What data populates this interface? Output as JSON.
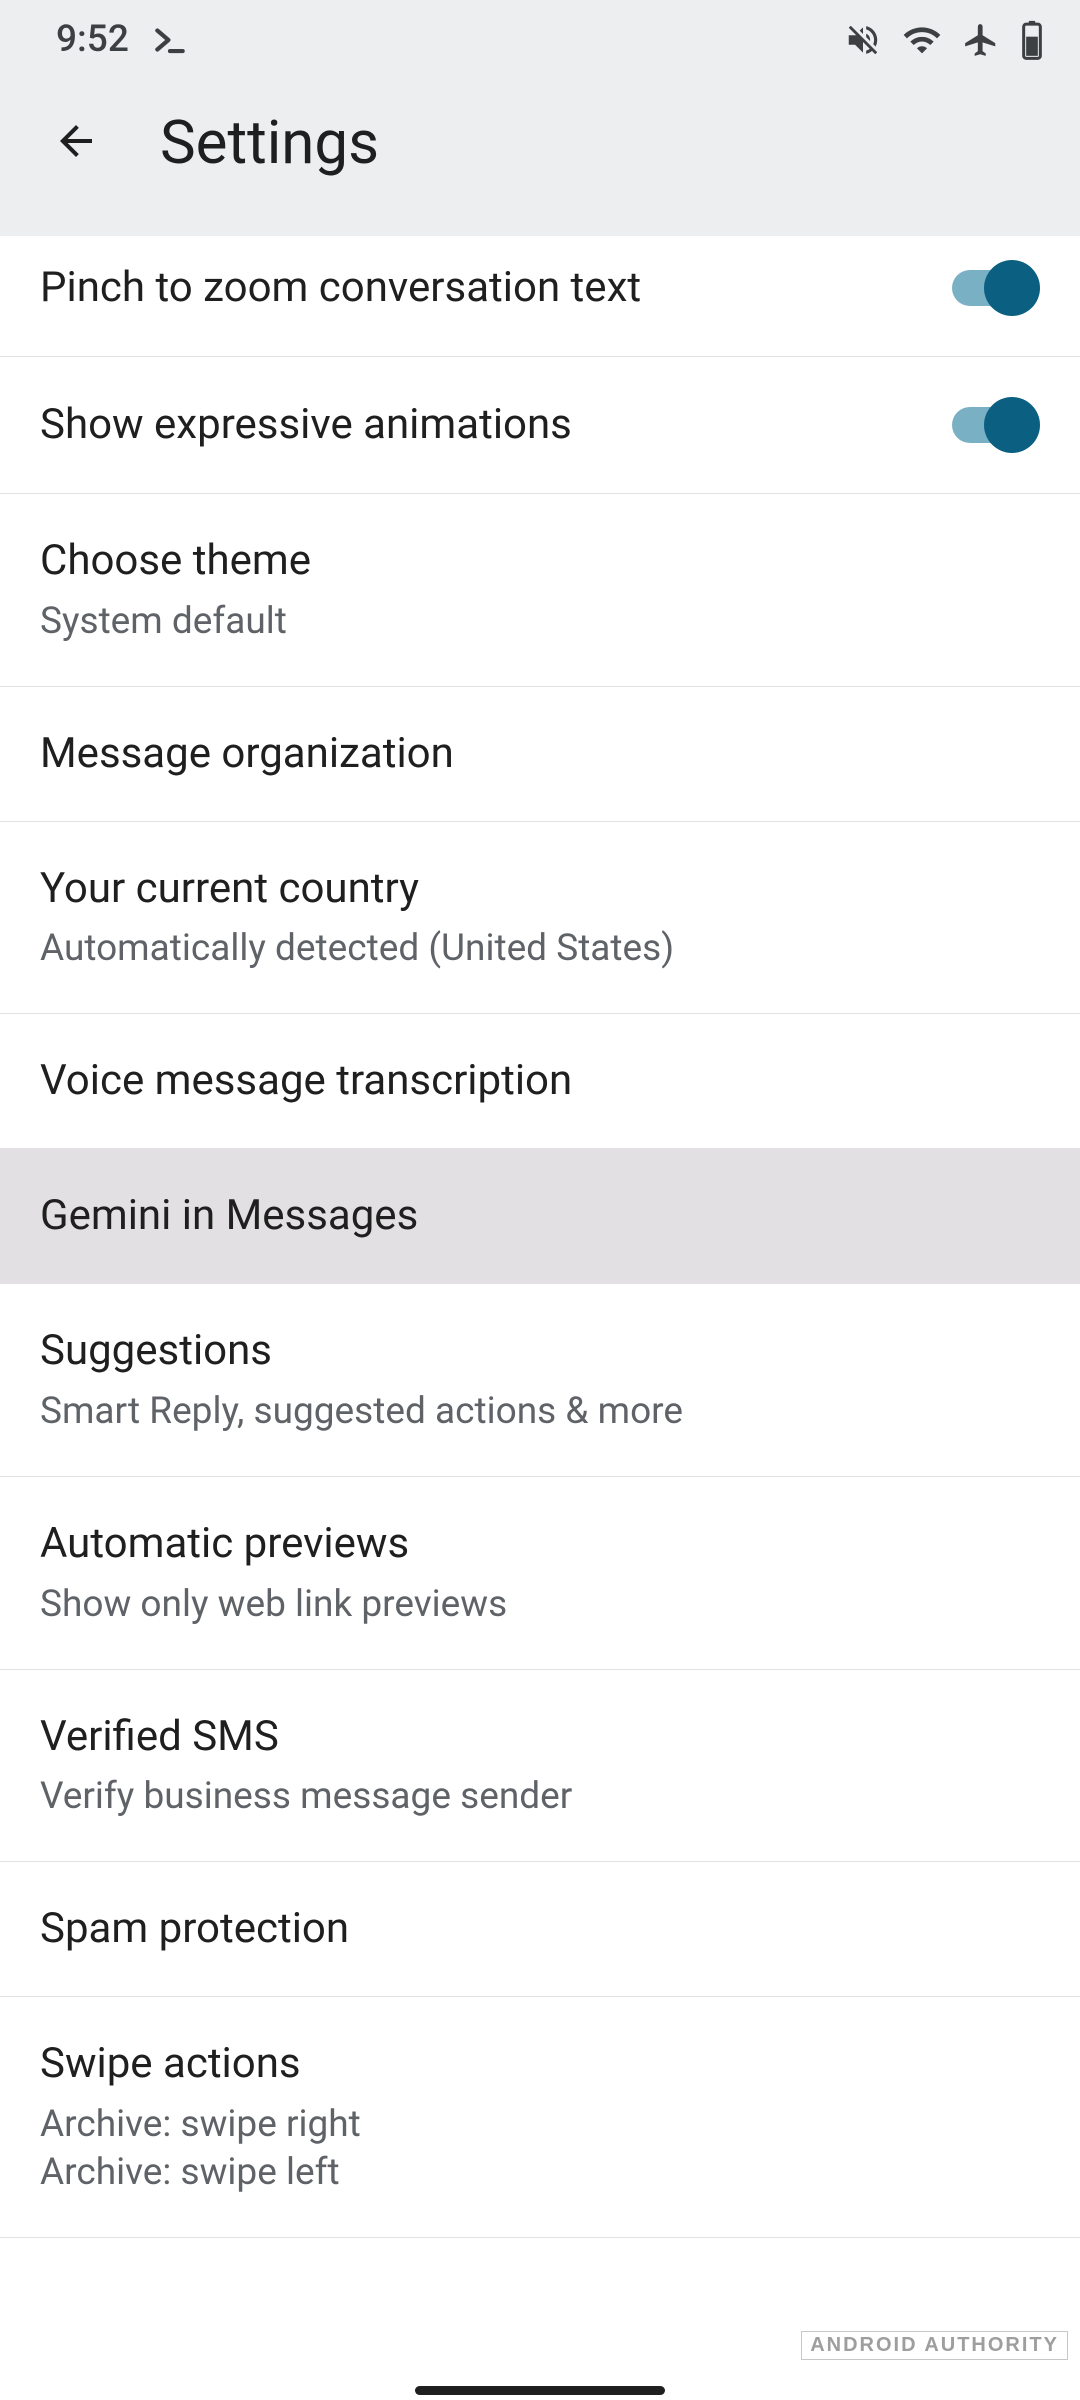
{
  "status": {
    "time": "9:52"
  },
  "header": {
    "title": "Settings"
  },
  "rows": {
    "pinch_zoom": {
      "title": "Pinch to zoom conversation text",
      "toggle": true
    },
    "animations": {
      "title": "Show expressive animations",
      "toggle": true
    },
    "theme": {
      "title": "Choose theme",
      "sub": "System default"
    },
    "organization": {
      "title": "Message organization"
    },
    "country": {
      "title": "Your current country",
      "sub": "Automatically detected (United States)"
    },
    "voice_transcription": {
      "title": "Voice message transcription"
    },
    "gemini": {
      "title": "Gemini in Messages"
    },
    "suggestions": {
      "title": "Suggestions",
      "sub": "Smart Reply, suggested actions & more"
    },
    "previews": {
      "title": "Automatic previews",
      "sub": "Show only web link previews"
    },
    "verified_sms": {
      "title": "Verified SMS",
      "sub": "Verify business message sender"
    },
    "spam": {
      "title": "Spam protection"
    },
    "swipe": {
      "title": "Swipe actions",
      "sub1": "Archive: swipe right",
      "sub2": "Archive: swipe left"
    }
  },
  "watermark": "ANDROID AUTHORITY"
}
